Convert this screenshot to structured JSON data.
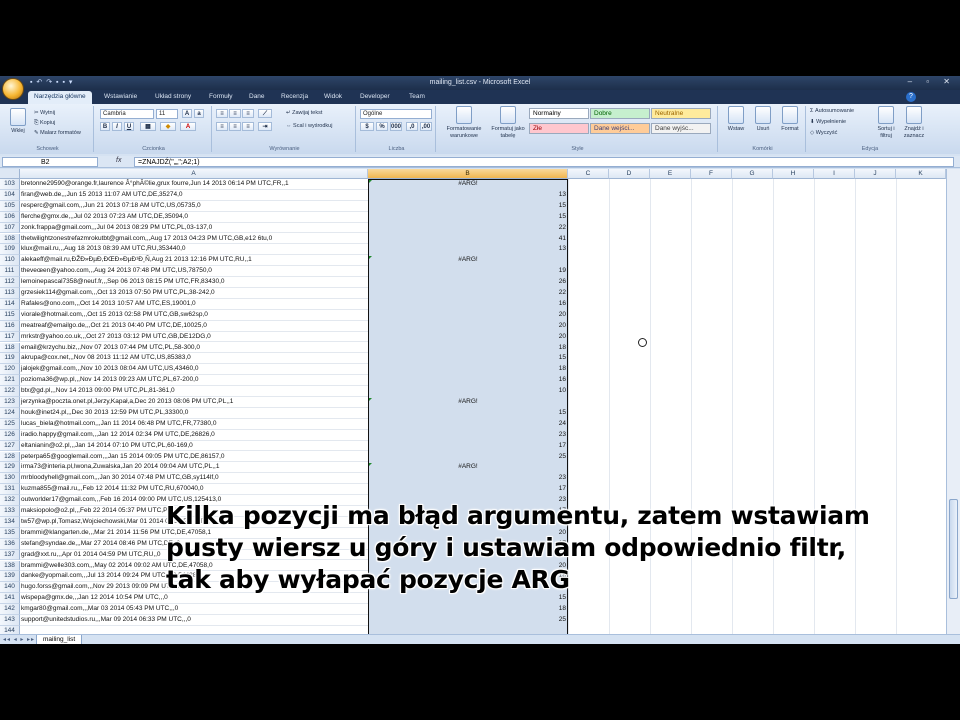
{
  "window": {
    "title": "mailing_list.csv - Microsoft Excel",
    "controls": "– ▫ ✕"
  },
  "tabs": [
    "Narzędzia główne",
    "Wstawianie",
    "Układ strony",
    "Formuły",
    "Dane",
    "Recenzja",
    "Widok",
    "Developer",
    "Team"
  ],
  "ribbon": {
    "clipboard": {
      "label": "Schowek",
      "paste": "Wklej",
      "cut": "Wytnij",
      "copy": "Kopiuj",
      "painter": "Malarz formatów"
    },
    "font": {
      "label": "Czcionka",
      "name": "Cambria",
      "size": "11",
      "bold": "B",
      "italic": "I",
      "underline": "U"
    },
    "alignment": {
      "label": "Wyrównanie",
      "wrap": "Zawijaj tekst",
      "merge": "Scal i wyśrodkuj"
    },
    "number": {
      "label": "Liczba",
      "format": "Ogólne"
    },
    "styles": {
      "label": "Style",
      "cond": "Formatowanie warunkowe",
      "table": "Formatuj jako tabelę",
      "items": [
        {
          "text": "Normalny",
          "bg": "#ffffff",
          "fg": "#000000"
        },
        {
          "text": "Dobre",
          "bg": "#c6efce",
          "fg": "#006100"
        },
        {
          "text": "Neutralne",
          "bg": "#ffeb9c",
          "fg": "#9c6500"
        },
        {
          "text": "Złe",
          "bg": "#ffc7ce",
          "fg": "#9c0006"
        },
        {
          "text": "Dane wejści...",
          "bg": "#ffcc99",
          "fg": "#3f3f76"
        },
        {
          "text": "Dane wyjśc...",
          "bg": "#f2f2f2",
          "fg": "#3f3f3f"
        }
      ]
    },
    "cells": {
      "label": "Komórki",
      "insert": "Wstaw",
      "delete": "Usuń",
      "format": "Format"
    },
    "editing": {
      "label": "Edycja",
      "autosum": "Autosumowanie",
      "fill": "Wypełnienie",
      "clear": "Wyczyść",
      "sort": "Sortuj i filtruj",
      "find": "Znajdź i zaznacz"
    }
  },
  "formula_bar": {
    "cell": "B2",
    "fx": "fx",
    "formula": "=ZNAJDŹ(\"„„\";A2;1)"
  },
  "columns": [
    "A",
    "B",
    "C",
    "D",
    "E",
    "F",
    "G",
    "H",
    "I",
    "J",
    "K"
  ],
  "rows": [
    {
      "n": "103",
      "a": "bretonne29590@orange.fr,laurence Â°phÃ©lie,grux fourre,Jun 14 2013 06:14 PM UTC,FR,,1",
      "b": "#ARG!"
    },
    {
      "n": "104",
      "a": "firan@web.de,,,Jun 15 2013 11:07 AM UTC,DE,35274,0",
      "b": "13"
    },
    {
      "n": "105",
      "a": "resperc@gmail.com,,,Jun 21 2013 07:18 AM UTC,US,05735,0",
      "b": "15"
    },
    {
      "n": "106",
      "a": "flerche@gmx.de,,,Jul 02 2013 07:23 AM UTC,DE,35094,0",
      "b": "15"
    },
    {
      "n": "107",
      "a": "zonk.frappa@gmail.com,,,Jul 04 2013 08:29 PM UTC,PL,03-137,0",
      "b": "22"
    },
    {
      "n": "108",
      "a": "thetwilightzonestrefazmrokutbt@gmail.com,,,Aug 17 2013 04:23 PM UTC,GB,e12 6tu,0",
      "b": "41"
    },
    {
      "n": "109",
      "a": "klux@mail.ru,,,Aug 18 2013 08:39 AM UTC,RU,353440,0",
      "b": "13"
    },
    {
      "n": "110",
      "a": "alekaeff@mail.ru,ÐŽÐ»ÐµÐ,ÐŒÐ»ÐµÐ¹Ð¸Ñ,Aug 21 2013 12:16 PM UTC,RU,,1",
      "b": "#ARG!"
    },
    {
      "n": "111",
      "a": "theveœen@yahoo.com,,,Aug 24 2013 07:48 PM UTC,US,78750,0",
      "b": "19"
    },
    {
      "n": "112",
      "a": "lemoinepascal7358@neuf.fr,,,Sep 06 2013 08:15 PM UTC,FR,83430,0",
      "b": "26"
    },
    {
      "n": "113",
      "a": "grzesiek114@gmail.com,,,Oct 13 2013 07:50 PM UTC,PL,38-242,0",
      "b": "22"
    },
    {
      "n": "114",
      "a": "Rafales@ono.com,,,Oct 14 2013 10:57 AM UTC,ES,19001,0",
      "b": "16"
    },
    {
      "n": "115",
      "a": "viorale@hotmail.com,,,Oct 15 2013 02:58 PM UTC,GB,sw62sp,0",
      "b": "20"
    },
    {
      "n": "116",
      "a": "meatreaf@emailgo.de,,,Oct 21 2013 04:40 PM UTC,DE,10025,0",
      "b": "20"
    },
    {
      "n": "117",
      "a": "mrkstr@yahoo.co.uk,,,Oct 27 2013 03:12 PM UTC,GB,DE12DG,0",
      "b": "20"
    },
    {
      "n": "118",
      "a": "email@krzychu.biz,,,Nov 07 2013 07:44 PM UTC,PL,58-300,0",
      "b": "18"
    },
    {
      "n": "119",
      "a": "akrupa@cox.net,,,Nov 08 2013 11:12 AM UTC,US,85383,0",
      "b": "15"
    },
    {
      "n": "120",
      "a": "jalojek@gmail.com,,,Nov 10 2013 08:04 AM UTC,US,43460,0",
      "b": "18"
    },
    {
      "n": "121",
      "a": "pozioma36@wp.pl,,,Nov 14 2013 09:23 AM UTC,PL,67-200,0",
      "b": "16"
    },
    {
      "n": "122",
      "a": "btx@gd.pl,,,Nov 14 2013 09:00 PM UTC,PL,81-361,0",
      "b": "10"
    },
    {
      "n": "123",
      "a": "jerzynka@poczta.onet.pl,Jerzy,Kapał,a,Dec 20 2013 08:06 PM UTC,PL,,1",
      "b": "#ARG!"
    },
    {
      "n": "124",
      "a": "houk@inet24.pl,,,Dec 30 2013 12:59 PM UTC,PL,33300,0",
      "b": "15"
    },
    {
      "n": "125",
      "a": "lucas_biela@hotmail.com,,,Jan 11 2014 06:48 PM UTC,FR,77380,0",
      "b": "24"
    },
    {
      "n": "126",
      "a": "iradio.happy@gmail.com,,,Jan 12 2014 02:34 PM UTC,DE,26826,0",
      "b": "23"
    },
    {
      "n": "127",
      "a": "eltanianin@o2.pl,,,Jan 14 2014 07:10 PM UTC,PL,60-169,0",
      "b": "17"
    },
    {
      "n": "128",
      "a": "peterpa65@googlemail.com,,,Jan 15 2014 09:05 PM UTC,DE,86157,0",
      "b": "25"
    },
    {
      "n": "129",
      "a": "irma73@interia.pl,Iwona,Zuwalska,Jan 20 2014 09:04 AM UTC,PL,,1",
      "b": "#ARG!"
    },
    {
      "n": "130",
      "a": "mrbloodyhell@gmail.com,,,Jan 30 2014 07:48 PM UTC,GB,sy114lf,0",
      "b": "23"
    },
    {
      "n": "131",
      "a": "kuzma855@mail.ru,,,Feb 12 2014 11:32 PM UTC,RU,670040,0",
      "b": "17"
    },
    {
      "n": "132",
      "a": "outworlder17@gmail.com,,,Feb 16 2014 09:00 PM UTC,US,125413,0",
      "b": "23"
    },
    {
      "n": "133",
      "a": "maksiopolo@o2.pl,,,Feb 22 2014 05:37 PM UTC,PL,,0",
      "b": "17"
    },
    {
      "n": "134",
      "a": "tw57@wp.pl,Tomasz,Wojciechowski,Mar 01 2014 03:52 PM UTC,PL,,1",
      "b": "11"
    },
    {
      "n": "135",
      "a": "brammi@klangarten.de,,,Mar 21 2014 11:56 PM UTC,DE,47058,1",
      "b": "20"
    },
    {
      "n": "136",
      "a": "stefan@syndae.de,,,Mar 27 2014 08:46 PM UTC,DE,,0",
      "b": "17"
    },
    {
      "n": "137",
      "a": "grad@xxt.ru,,,Apr 01 2014 04:59 PM UTC,RU,,0",
      "b": "12"
    },
    {
      "n": "138",
      "a": "brammi@welle303.com,,,May 02 2014 09:02 AM UTC,DE,47058,0",
      "b": "20"
    },
    {
      "n": "139",
      "a": "danke@yopmail.com,,,Jul 13 2014 09:24 PM UTC,US,54488,0",
      "b": "18"
    },
    {
      "n": "140",
      "a": "hugo.forss@gmail.com,,,Nov 29 2013 09:09 PM UTC,SE,,0",
      "b": "21"
    },
    {
      "n": "141",
      "a": "wispepa@gmx.de,,,Jan 12 2014 10:54 PM UTC,,,0",
      "b": "15"
    },
    {
      "n": "142",
      "a": "kmgar80@gmail.com,,,Mar 03 2014 05:43 PM UTC,,,0",
      "b": "18"
    },
    {
      "n": "143",
      "a": "support@unitedstudios.ru,,,Mar 09 2014 06:33 PM UTC,,,0",
      "b": "25"
    },
    {
      "n": "144",
      "a": "",
      "b": ""
    }
  ],
  "sheet": {
    "tab": "mailing_list",
    "nav": "◂◂ ◂ ▸ ▸▸"
  },
  "subtitle": [
    "Kilka pozycji ma błąd argumentu, zatem wstawiam",
    "pusty wiersz u góry i ustawiam odpowiednio filtr,",
    "tak aby wyłapać pozycje ARG"
  ]
}
